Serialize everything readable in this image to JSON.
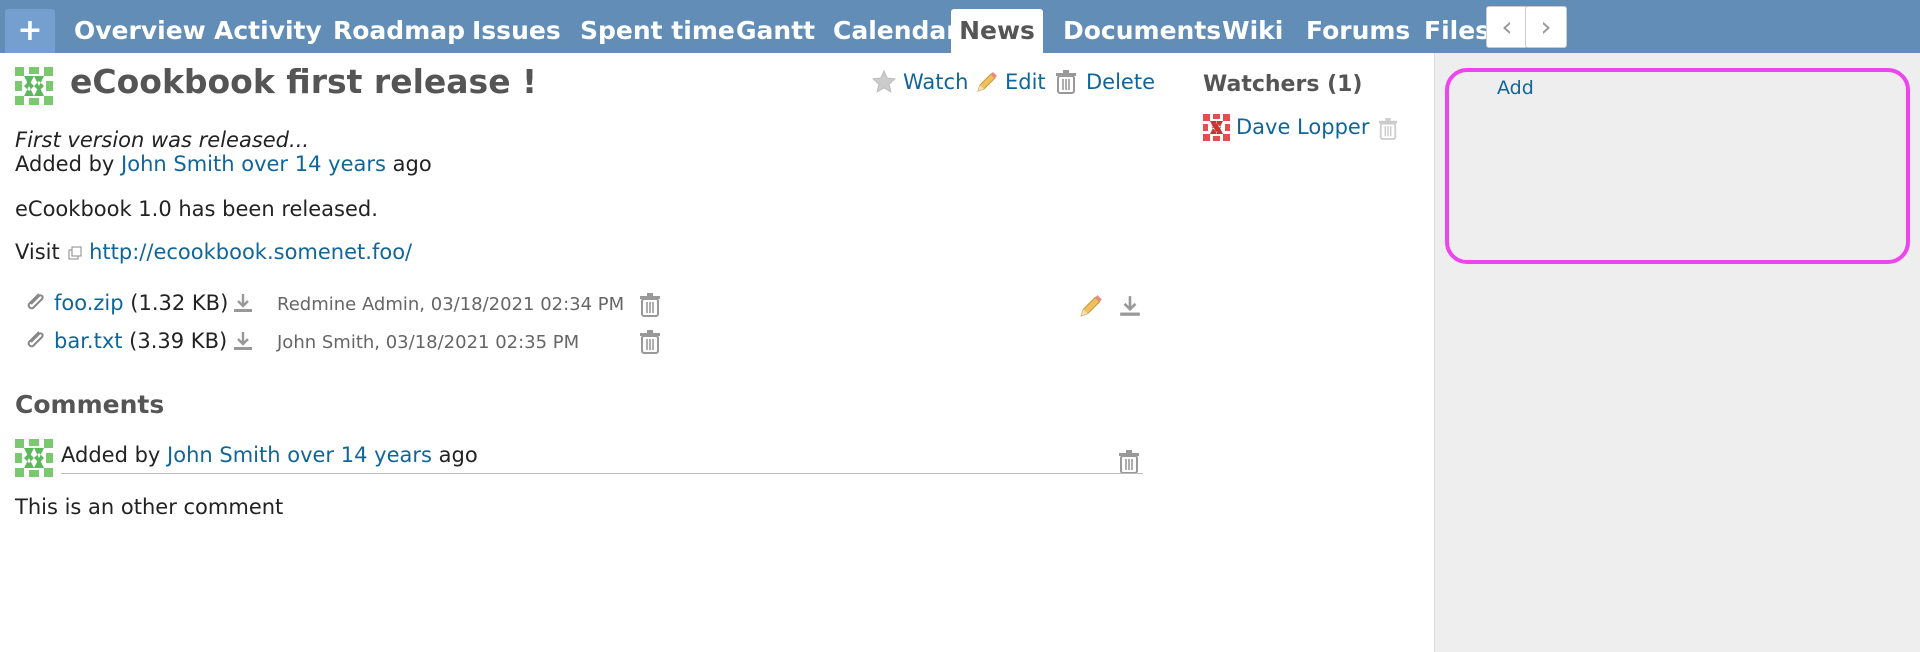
{
  "tabs": {
    "plus": "+",
    "overview": "Overview",
    "activity": "Activity",
    "roadmap": "Roadmap",
    "issues": "Issues",
    "spent_time": "Spent time",
    "gantt": "Gantt",
    "calendar": "Calendar",
    "news": "News",
    "documents": "Documents",
    "wiki": "Wiki",
    "forums": "Forums",
    "files": "Files",
    "selected": "News"
  },
  "news": {
    "title": "eCookbook first release !",
    "summary": "First version was released...",
    "added_by_prefix": "Added by",
    "author": "John Smith",
    "age": "over 14 years",
    "age_suffix": "ago",
    "body_line1": "eCookbook 1.0 has been released.",
    "visit_label": "Visit",
    "link": "http://ecookbook.somenet.foo/"
  },
  "actions": {
    "watch": "Watch",
    "edit": "Edit",
    "delete": "Delete"
  },
  "attachments": [
    {
      "name": "foo.zip",
      "size": "(1.32 KB)",
      "author_date": "Redmine Admin, 03/18/2021 02:34 PM"
    },
    {
      "name": "bar.txt",
      "size": "(3.39 KB)",
      "author_date": "John Smith, 03/18/2021 02:35 PM"
    }
  ],
  "comments": {
    "heading": "Comments",
    "items": [
      {
        "added_by_prefix": "Added by",
        "author": "John Smith",
        "age": "over 14 years",
        "age_suffix": "ago",
        "text": "This is an other comment"
      }
    ]
  },
  "sidebar": {
    "watchers_title": "Watchers (1)",
    "add_label": "Add",
    "watchers": [
      {
        "name": "Dave Lopper"
      }
    ]
  },
  "colors": {
    "tabbar": "#628db6",
    "link": "#116699",
    "sidebar_bg": "#eeeeee",
    "highlight_border": "#ee44ee"
  }
}
